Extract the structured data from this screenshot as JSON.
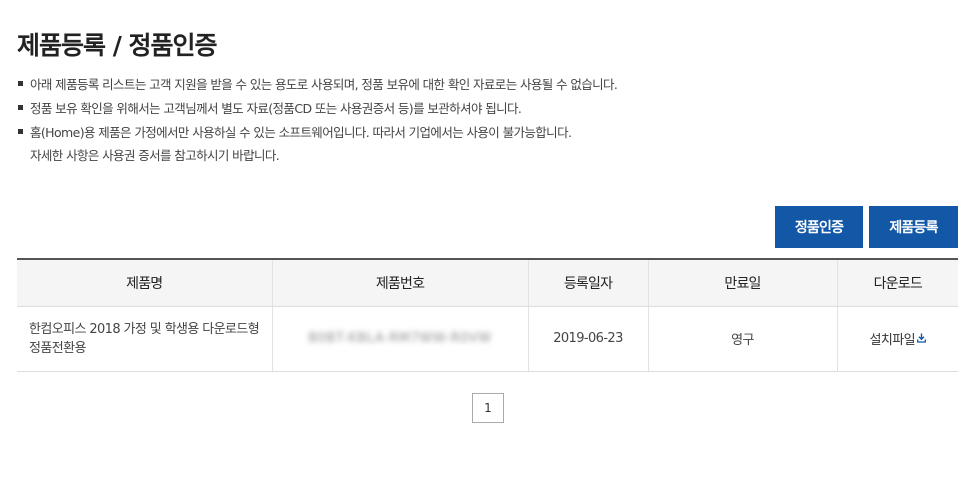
{
  "page": {
    "title": "제품등록 / 정품인증"
  },
  "notes": [
    {
      "text": "아래 제품등록 리스트는 고객 지원을 받을 수 있는 용도로 사용되며, 정품 보유에 대한 확인 자료로는 사용될 수 없습니다."
    },
    {
      "text": "정품 보유 확인을 위해서는 고객님께서 별도 자료(정품CD 또는 사용권증서 등)를 보관하셔야 됩니다."
    },
    {
      "text": "홈(Home)용 제품은 가정에서만 사용하실 수 있는 소프트웨어입니다. 따라서 기업에서는 사용이 불가능합니다.",
      "text2": "자세한 사항은 사용권 증서를 참고하시기 바랍니다."
    }
  ],
  "buttons": {
    "auth_label": "정품인증",
    "register_label": "제품등록"
  },
  "table": {
    "headers": [
      "제품명",
      "제품번호",
      "등록일자",
      "만료일",
      "다운로드"
    ],
    "rows": [
      {
        "name": "한컴오피스 2018 가정 및 학생용 다운로드형 정품전환용",
        "serial": "B0BT-KBLA-RM7WW-R0VW",
        "date": "2019-06-23",
        "expiry": "영구",
        "download": "설치파일"
      }
    ]
  },
  "pagination": {
    "current": "1"
  },
  "colors": {
    "primary": "#1258a6",
    "header_bg": "#f5f5f5"
  }
}
